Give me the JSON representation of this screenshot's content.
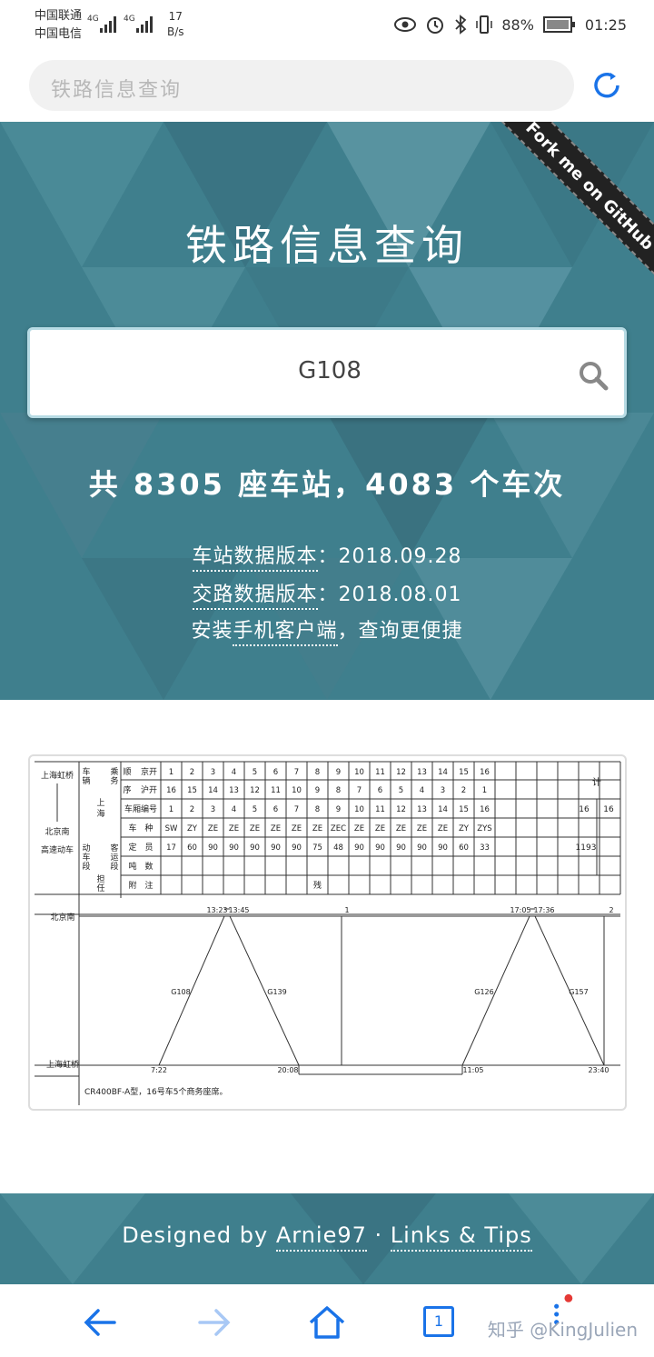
{
  "status_bar": {
    "carrier_1": "中国联通",
    "carrier_2": "中国电信",
    "net_1": "4G",
    "net_2": "4G",
    "speed_value": "17",
    "speed_unit": "B/s",
    "battery": "88%",
    "time": "01:25"
  },
  "address_bar": {
    "url_text": "铁路信息查询",
    "reload_icon": "reload-icon"
  },
  "hero": {
    "title": "铁路信息查询",
    "fork_ribbon": "Fork me on GitHub",
    "search_value": "G108",
    "stats": "共 8305 座车站，4083 个车次",
    "station_label": "车站数据版本",
    "station_value": "：2018.09.28",
    "route_label": "交路数据版本",
    "route_value": "：2018.08.01",
    "install_prefix": "安装",
    "install_link": "手机客户端",
    "install_suffix": "，查询更便捷"
  },
  "diagram": {
    "route_top": "上海虹桥",
    "route_bottom": "北京南",
    "operator": "高速动车",
    "label_vehicle": "车辆",
    "label_crew": "乘务",
    "label_order": "顺",
    "label_order2": "序",
    "label_jingkai": "京开",
    "label_hukai": "沪开",
    "label_shanghai": "上海",
    "label_carno": "车厢编号",
    "label_type": "车　种",
    "label_capacity": "定　员",
    "label_tonnage": "吨　数",
    "label_note": "附　注",
    "label_depot": "动车段",
    "label_passenger": "客运段",
    "label_bear": "担任",
    "label_total": "计",
    "jingkai_order": [
      "1",
      "2",
      "3",
      "4",
      "5",
      "6",
      "7",
      "8",
      "9",
      "10",
      "11",
      "12",
      "13",
      "14",
      "15",
      "16"
    ],
    "hukai_order": [
      "16",
      "15",
      "14",
      "13",
      "12",
      "11",
      "10",
      "9",
      "8",
      "7",
      "6",
      "5",
      "4",
      "3",
      "2",
      "1"
    ],
    "car_numbers": [
      "1",
      "2",
      "3",
      "4",
      "5",
      "6",
      "7",
      "8",
      "9",
      "10",
      "11",
      "12",
      "13",
      "14",
      "15",
      "16"
    ],
    "car_types": [
      "SW",
      "ZY",
      "ZE",
      "ZE",
      "ZE",
      "ZE",
      "ZE",
      "ZE",
      "ZEC",
      "ZE",
      "ZE",
      "ZE",
      "ZE",
      "ZE",
      "ZY",
      "ZYS"
    ],
    "capacity": [
      "17",
      "60",
      "90",
      "90",
      "90",
      "90",
      "90",
      "75",
      "48",
      "90",
      "90",
      "90",
      "90",
      "90",
      "60",
      "33"
    ],
    "total_cars_a": "16",
    "total_cars_b": "16",
    "total_capacity": "1193",
    "note_car8": "残",
    "station_beijing": "北京南",
    "station_shanghai": "上海虹桥",
    "trains": [
      "G108",
      "G139",
      "G126",
      "G157"
    ],
    "times": {
      "t1": "13:23",
      "t2": "13:45",
      "t3": "7:22",
      "t4": "20:08",
      "t5": "17:05",
      "t6": "17:36",
      "t7": "11:05",
      "t8": "23:40"
    },
    "turn_1": "1",
    "turn_2": "2",
    "footnote": "CR400BF-A型，16号车5个商务座席。"
  },
  "footer": {
    "designed_by": "Designed by ",
    "author": "Arnie97",
    "separator": " · ",
    "links": "Links & Tips"
  },
  "bottom_nav": {
    "tab_count": "1",
    "watermark": "知乎 @KingJulien"
  },
  "colors": {
    "hero_bg": "#3f7f8d",
    "nav_blue": "#1a73e8",
    "search_border": "#b7dbe4"
  }
}
